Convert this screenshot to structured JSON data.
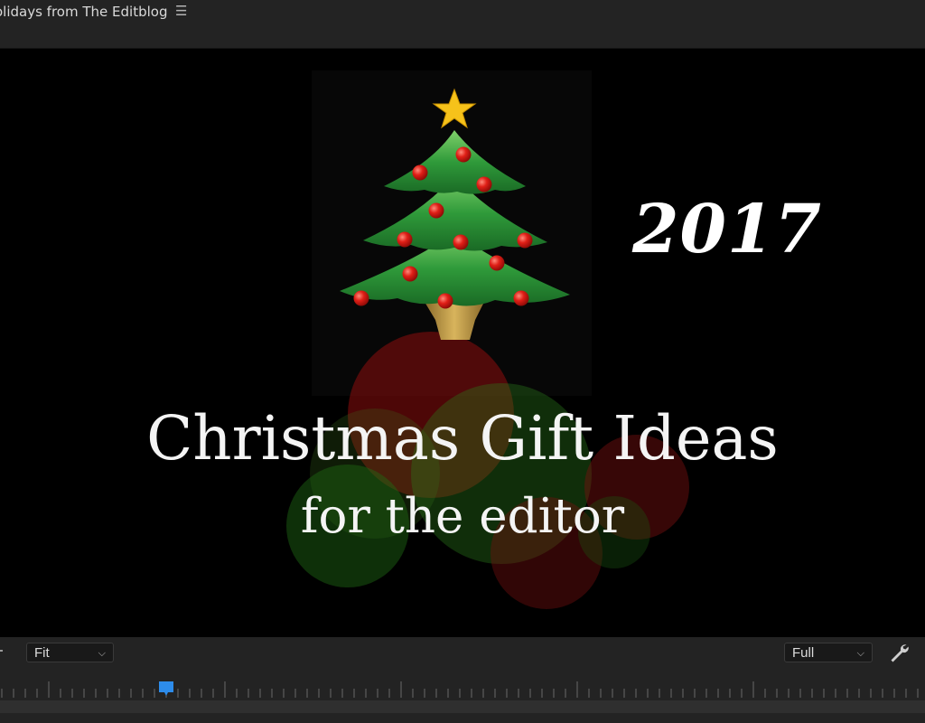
{
  "panel": {
    "title": "olidays from The Editblog",
    "menu_icon": "hamburger-menu-icon"
  },
  "frame": {
    "year": "2017",
    "headline": "Christmas Gift Ideas",
    "subhead": "for the editor"
  },
  "controls": {
    "zoom_label": "Fit",
    "resolution_label": "Full",
    "chevron": "⌵",
    "settings_icon": "wrench-icon",
    "playhead_color": "#2d8ceb"
  }
}
